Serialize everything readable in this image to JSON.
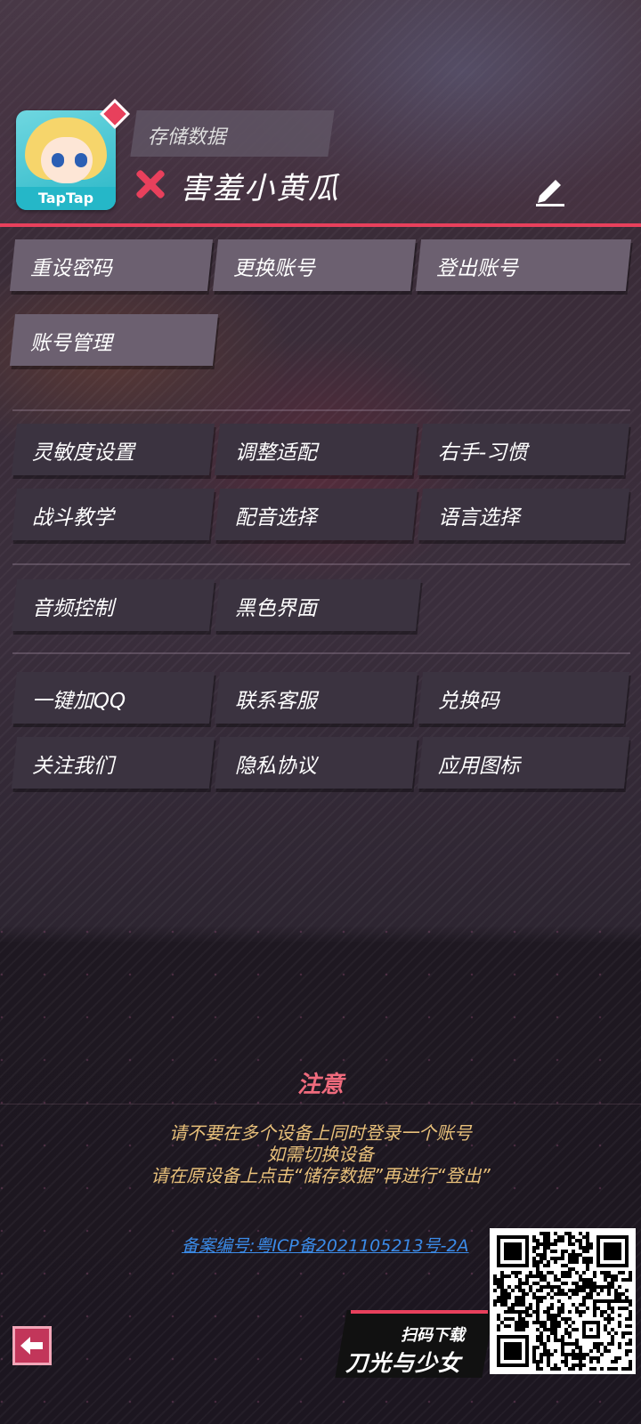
{
  "header": {
    "save_label": "存储数据",
    "username": "害羞小黄瓜",
    "avatar_logo": "TapTap"
  },
  "account_buttons": {
    "reset_password": "重设密码",
    "switch_account": "更换账号",
    "logout": "登出账号",
    "account_manage": "账号管理"
  },
  "settings_buttons": {
    "sensitivity": "灵敏度设置",
    "adjust_fit": "调整适配",
    "right_hand": "右手-习惯",
    "combat_tutorial": "战斗教学",
    "voice_select": "配音选择",
    "language_select": "语言选择",
    "audio_control": "音频控制",
    "dark_mode": "黑色界面"
  },
  "community_buttons": {
    "join_qq": "一键加QQ",
    "contact_support": "联系客服",
    "redeem_code": "兑换码",
    "follow_us": "关注我们",
    "privacy": "隐私协议",
    "app_icon": "应用图标"
  },
  "notice": {
    "title": "注意",
    "line1": "请不要在多个设备上同时登录一个账号",
    "line2": "如需切换设备",
    "line3": "请在原设备上点击“储存数据”再进行“登出”"
  },
  "footer": {
    "icp": "备案编号:粤ICP备2021105213号-2A",
    "promo_small": "扫码下载",
    "promo_title": "刀光与少女"
  },
  "colors": {
    "accent": "#e8405c",
    "notice_text": "#e8c07a",
    "link": "#3b8be8"
  }
}
